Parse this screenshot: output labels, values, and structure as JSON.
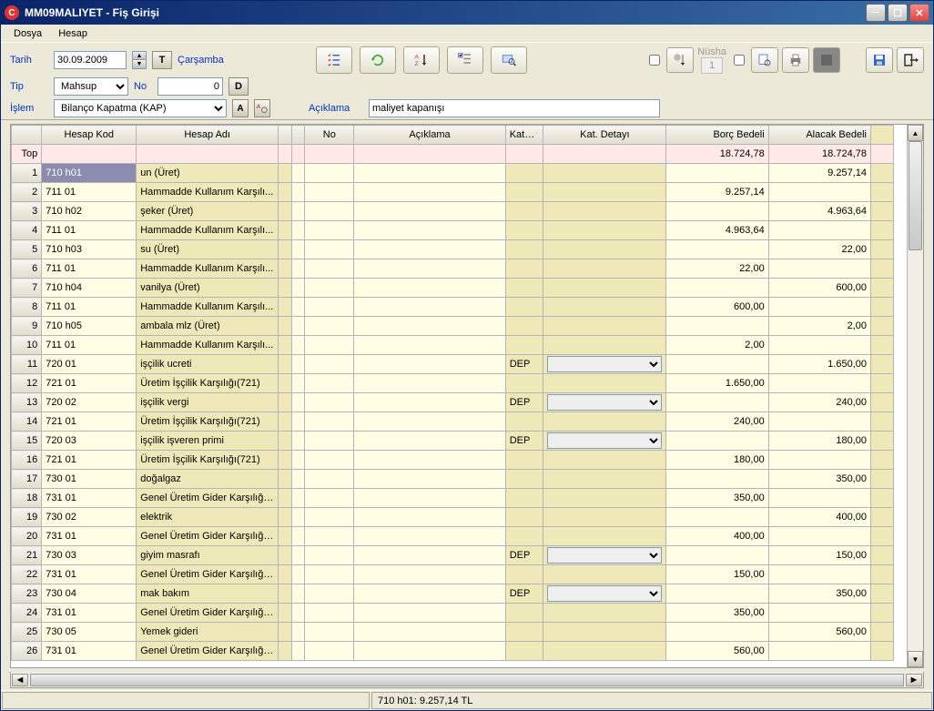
{
  "window": {
    "title": "MM09MALIYET - Fiş Girişi"
  },
  "menu": {
    "dosya": "Dosya",
    "hesap": "Hesap"
  },
  "form": {
    "tarih_label": "Tarih",
    "tarih_value": "30.09.2009",
    "t_label": "T",
    "day_label": "Çarşamba",
    "tip_label": "Tip",
    "tip_value": "Mahsup",
    "no_label": "No",
    "no_value": "0",
    "d_label": "D",
    "islem_label": "İşlem",
    "islem_value": "Bilanço Kapatma (KAP)",
    "a_label": "A",
    "aciklama_label": "Açıklama",
    "aciklama_value": "maliyet kapanışı",
    "nusha_label": "Nüsha",
    "nusha_value": "1"
  },
  "grid": {
    "headers": {
      "rownum": "",
      "hesapkod": "Hesap Kod",
      "hesapadi": "Hesap Adı",
      "no": "No",
      "aciklama": "Açıklama",
      "kategori": "Kategori",
      "katdetay": "Kat. Detayı",
      "borc": "Borç Bedeli",
      "alacak": "Alacak Bedeli"
    },
    "top_label": "Top",
    "top_borc": "18.724,78",
    "top_alacak": "18.724,78",
    "rows": [
      {
        "n": "1",
        "kod": "710 h01",
        "ad": "un (Üret)",
        "kat": "",
        "detaySel": false,
        "borc": "",
        "alacak": "9.257,14",
        "selected": true
      },
      {
        "n": "2",
        "kod": "711 01",
        "ad": "Hammadde Kullanım Karşılı...",
        "kat": "",
        "detaySel": false,
        "borc": "9.257,14",
        "alacak": ""
      },
      {
        "n": "3",
        "kod": "710 h02",
        "ad": "şeker (Üret)",
        "kat": "",
        "detaySel": false,
        "borc": "",
        "alacak": "4.963,64"
      },
      {
        "n": "4",
        "kod": "711 01",
        "ad": "Hammadde Kullanım Karşılı...",
        "kat": "",
        "detaySel": false,
        "borc": "4.963,64",
        "alacak": ""
      },
      {
        "n": "5",
        "kod": "710 h03",
        "ad": "su (Üret)",
        "kat": "",
        "detaySel": false,
        "borc": "",
        "alacak": "22,00"
      },
      {
        "n": "6",
        "kod": "711 01",
        "ad": "Hammadde Kullanım Karşılı...",
        "kat": "",
        "detaySel": false,
        "borc": "22,00",
        "alacak": ""
      },
      {
        "n": "7",
        "kod": "710 h04",
        "ad": "vanilya (Üret)",
        "kat": "",
        "detaySel": false,
        "borc": "",
        "alacak": "600,00"
      },
      {
        "n": "8",
        "kod": "711 01",
        "ad": "Hammadde Kullanım Karşılı...",
        "kat": "",
        "detaySel": false,
        "borc": "600,00",
        "alacak": ""
      },
      {
        "n": "9",
        "kod": "710 h05",
        "ad": "ambala mlz (Üret)",
        "kat": "",
        "detaySel": false,
        "borc": "",
        "alacak": "2,00"
      },
      {
        "n": "10",
        "kod": "711 01",
        "ad": "Hammadde Kullanım Karşılı...",
        "kat": "",
        "detaySel": false,
        "borc": "2,00",
        "alacak": ""
      },
      {
        "n": "11",
        "kod": "720 01",
        "ad": "işçilik ucreti",
        "kat": "DEP",
        "detaySel": true,
        "borc": "",
        "alacak": "1.650,00"
      },
      {
        "n": "12",
        "kod": "721 01",
        "ad": "Üretim İşçilik Karşılığı(721)",
        "kat": "",
        "detaySel": false,
        "borc": "1.650,00",
        "alacak": ""
      },
      {
        "n": "13",
        "kod": "720 02",
        "ad": "işçilik vergi",
        "kat": "DEP",
        "detaySel": true,
        "borc": "",
        "alacak": "240,00"
      },
      {
        "n": "14",
        "kod": "721 01",
        "ad": "Üretim İşçilik Karşılığı(721)",
        "kat": "",
        "detaySel": false,
        "borc": "240,00",
        "alacak": ""
      },
      {
        "n": "15",
        "kod": "720 03",
        "ad": "işçilik işveren primi",
        "kat": "DEP",
        "detaySel": true,
        "borc": "",
        "alacak": "180,00"
      },
      {
        "n": "16",
        "kod": "721 01",
        "ad": "Üretim İşçilik Karşılığı(721)",
        "kat": "",
        "detaySel": false,
        "borc": "180,00",
        "alacak": ""
      },
      {
        "n": "17",
        "kod": "730 01",
        "ad": "doğalgaz",
        "kat": "",
        "detaySel": false,
        "borc": "",
        "alacak": "350,00"
      },
      {
        "n": "18",
        "kod": "731 01",
        "ad": "Genel Üretim Gider Karşılığı...",
        "kat": "",
        "detaySel": false,
        "borc": "350,00",
        "alacak": ""
      },
      {
        "n": "19",
        "kod": "730 02",
        "ad": "elektrik",
        "kat": "",
        "detaySel": false,
        "borc": "",
        "alacak": "400,00"
      },
      {
        "n": "20",
        "kod": "731 01",
        "ad": "Genel Üretim Gider Karşılığı...",
        "kat": "",
        "detaySel": false,
        "borc": "400,00",
        "alacak": ""
      },
      {
        "n": "21",
        "kod": "730 03",
        "ad": "giyim masrafı",
        "kat": "DEP",
        "detaySel": true,
        "borc": "",
        "alacak": "150,00"
      },
      {
        "n": "22",
        "kod": "731 01",
        "ad": "Genel Üretim Gider Karşılığı...",
        "kat": "",
        "detaySel": false,
        "borc": "150,00",
        "alacak": ""
      },
      {
        "n": "23",
        "kod": "730 04",
        "ad": "mak bakım",
        "kat": "DEP",
        "detaySel": true,
        "borc": "",
        "alacak": "350,00"
      },
      {
        "n": "24",
        "kod": "731 01",
        "ad": "Genel Üretim Gider Karşılığı...",
        "kat": "",
        "detaySel": false,
        "borc": "350,00",
        "alacak": ""
      },
      {
        "n": "25",
        "kod": "730 05",
        "ad": "Yemek gideri",
        "kat": "",
        "detaySel": false,
        "borc": "",
        "alacak": "560,00"
      },
      {
        "n": "26",
        "kod": "731 01",
        "ad": "Genel Üretim Gider Karşılığı...",
        "kat": "",
        "detaySel": false,
        "borc": "560,00",
        "alacak": ""
      }
    ]
  },
  "status": {
    "text": "710 h01: 9.257,14 TL"
  }
}
